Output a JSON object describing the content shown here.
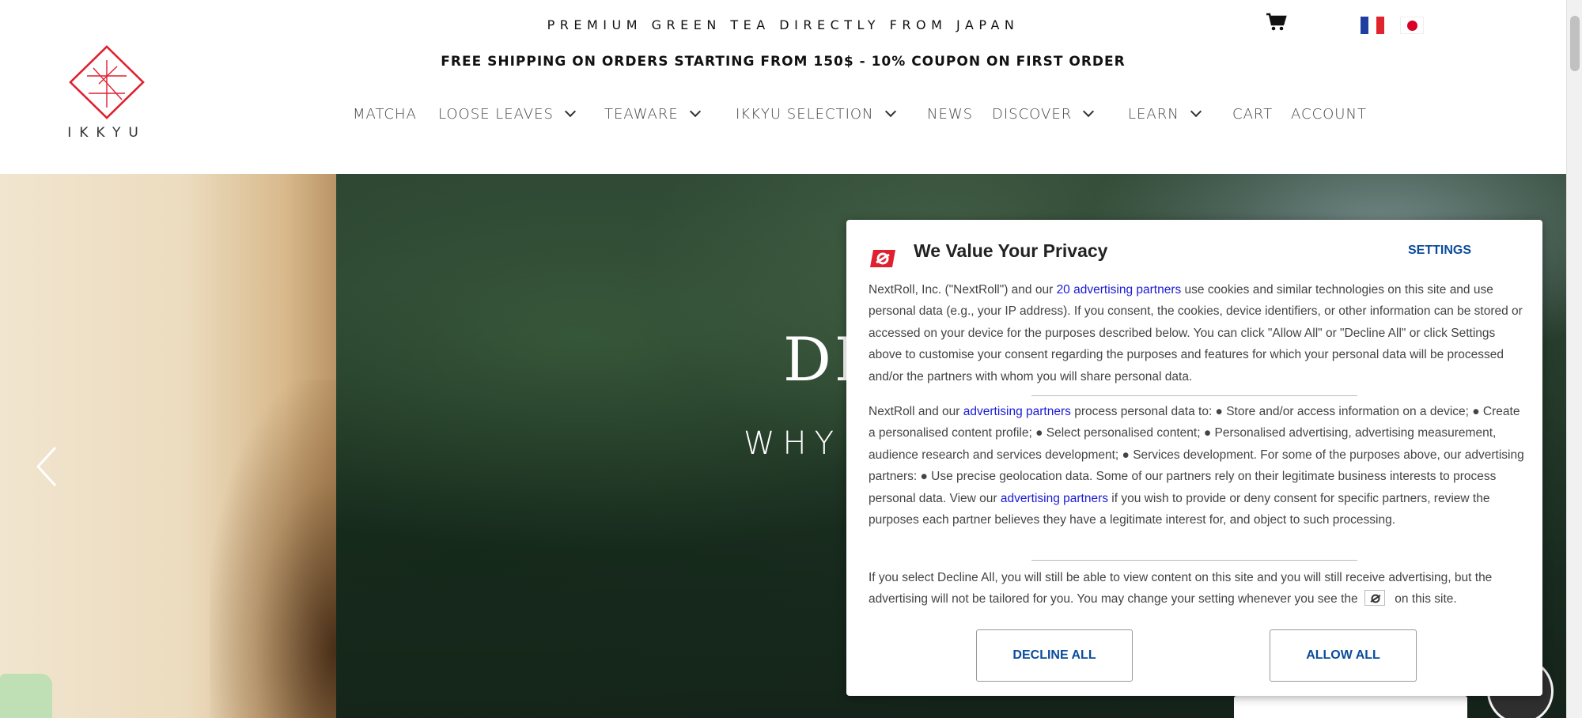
{
  "header": {
    "tagline": "PREMIUM GREEN TEA DIRECTLY FROM JAPAN",
    "shipping_banner": "FREE SHIPPING ON ORDERS STARTING FROM 150$ - 10% COUPON ON FIRST ORDER",
    "logo_text": "IKKYU",
    "brand_color": "#e0202e",
    "icons": {
      "cart": "cart-icon",
      "flag_fr": "flag-france-icon",
      "flag_jp": "flag-japan-icon"
    }
  },
  "nav": {
    "items": [
      {
        "label": "MATCHA",
        "dropdown": false
      },
      {
        "label": "LOOSE LEAVES",
        "dropdown": true
      },
      {
        "label": "TEAWARE",
        "dropdown": true
      },
      {
        "label": "IKKYU SELECTION",
        "dropdown": true
      },
      {
        "label": "NEWS",
        "dropdown": false
      },
      {
        "label": "DISCOVER",
        "dropdown": true
      },
      {
        "label": "LEARN",
        "dropdown": true
      },
      {
        "label": "CART",
        "dropdown": false
      },
      {
        "label": "ACCOUNT",
        "dropdown": false
      }
    ]
  },
  "hero": {
    "title_partial": "DI",
    "subtitle_partial": "WHY",
    "icons": {
      "prev": "chevron-left-icon"
    }
  },
  "consent": {
    "title": "We Value Your Privacy",
    "settings_label": "SETTINGS",
    "p1_before": "NextRoll, Inc. (\"NextRoll\") and our ",
    "p1_link": "20 advertising partners",
    "p1_after": " use cookies and similar technologies on this site and use personal data (e.g., your IP address). If you consent, the cookies, device identifiers, or other information can be stored or accessed on your device for the purposes described below. You can click \"Allow All\" or \"Decline All\" or click Settings above to customise your consent regarding the purposes and features for which your personal data will be processed and/or the partners with whom you will share personal data.",
    "p2_before": "NextRoll and our ",
    "p2_link1": "advertising partners",
    "p2_middle": " process personal data to: ● Store and/or access information on a device; ● Create a personalised content profile; ● Select personalised content; ● Personalised advertising, advertising measurement, audience research and services development; ● Services development. For some of the purposes above, our advertising partners: ● Use precise geolocation data. Some of our partners rely on their legitimate business interests to process personal data. View our ",
    "p2_link2": "advertising partners",
    "p2_after": " if you wish to provide or deny consent for specific partners, review the purposes each partner believes they have a legitimate interest for, and object to such processing.",
    "p3_before": "If you select Decline All, you will still be able to view content on this site and you will still receive advertising, but the advertising will not be tailored for you. You may change your setting whenever you see the ",
    "p3_after": " on this site.",
    "decline_label": "DECLINE ALL",
    "allow_label": "ALLOW ALL",
    "link_color": "#1a1ad6",
    "button_text_color": "#0a4c9c",
    "icons": {
      "brand": "nextroll-logo-icon",
      "inline": "nextroll-small-icon"
    }
  }
}
